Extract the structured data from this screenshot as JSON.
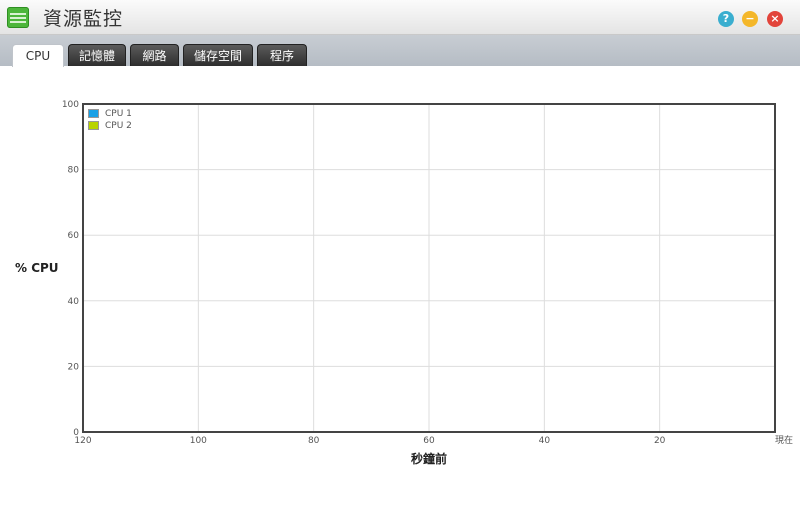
{
  "window": {
    "title": "資源監控",
    "help_icon": "help-icon",
    "minimize_icon": "minimize-icon",
    "close_icon": "close-icon"
  },
  "tabs": [
    {
      "label": "CPU",
      "active": true
    },
    {
      "label": "記憶體",
      "active": false
    },
    {
      "label": "網路",
      "active": false
    },
    {
      "label": "儲存空間",
      "active": false
    },
    {
      "label": "程序",
      "active": false
    }
  ],
  "colors": {
    "series1": "#1aa1e6",
    "series2": "#b8d400",
    "grid": "#dddddd",
    "axis": "#444444"
  },
  "chart_data": {
    "type": "line",
    "ylabel": "% CPU",
    "xlabel": "秒鐘前",
    "ylim": [
      0,
      100
    ],
    "xlim": [
      120,
      0
    ],
    "yticks": [
      "100",
      "80",
      "60",
      "40",
      "20",
      "0"
    ],
    "xticks": [
      "120",
      "100",
      "80",
      "60",
      "40",
      "20",
      "現在"
    ],
    "grid": true,
    "legend_position": "top-left",
    "series": [
      {
        "name": "CPU 1",
        "values": []
      },
      {
        "name": "CPU 2",
        "values": []
      }
    ]
  }
}
